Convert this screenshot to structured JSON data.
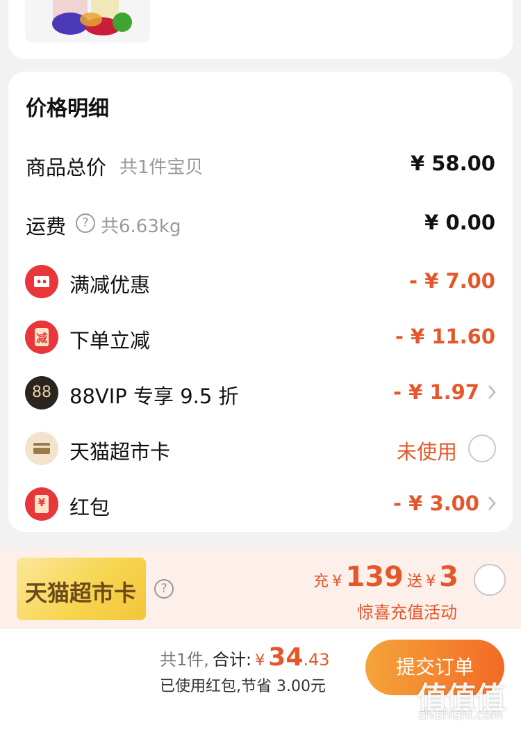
{
  "price_detail": {
    "title": "价格明细",
    "rows": [
      {
        "label": "商品总价",
        "sub": "共1件宝贝",
        "value": "¥ 58.00"
      },
      {
        "label": "运费",
        "sub": "共6.63kg",
        "value": "¥ 0.00"
      },
      {
        "label": "满减优惠",
        "value": "- ¥ 7.00"
      },
      {
        "label": "下单立减",
        "value": "- ¥ 11.60"
      },
      {
        "label": "88VIP 专享 9.5 折",
        "value": "- ¥ 1.97"
      },
      {
        "label": "天猫超市卡",
        "value": "未使用"
      },
      {
        "label": "红包",
        "value": "- ¥ 3.00"
      }
    ],
    "badge_texts": {
      "lijian": "减",
      "vip": "88",
      "hongbao": "¥"
    }
  },
  "promo": {
    "card_text": "天猫超市卡",
    "charge_label": "充",
    "charge_yen": "¥",
    "charge_amount": "139",
    "gift_label": "送",
    "gift_yen": "¥",
    "gift_amount": "3",
    "subtitle": "惊喜充值活动"
  },
  "footer": {
    "count_text": "共1件,",
    "total_label": "合计:",
    "yen": "¥",
    "total_int": "34",
    "total_dec": ".43",
    "saved_text": "已使用红包,节省 3.00元",
    "submit_label": "提交订单"
  },
  "watermark": {
    "glyphs": "值值值",
    "url": "zhizhizhi.com"
  },
  "colors": {
    "accent": "#e4572a",
    "button_start": "#f5a43a",
    "button_end": "#f36a25",
    "badge_red": "#e8363a"
  }
}
